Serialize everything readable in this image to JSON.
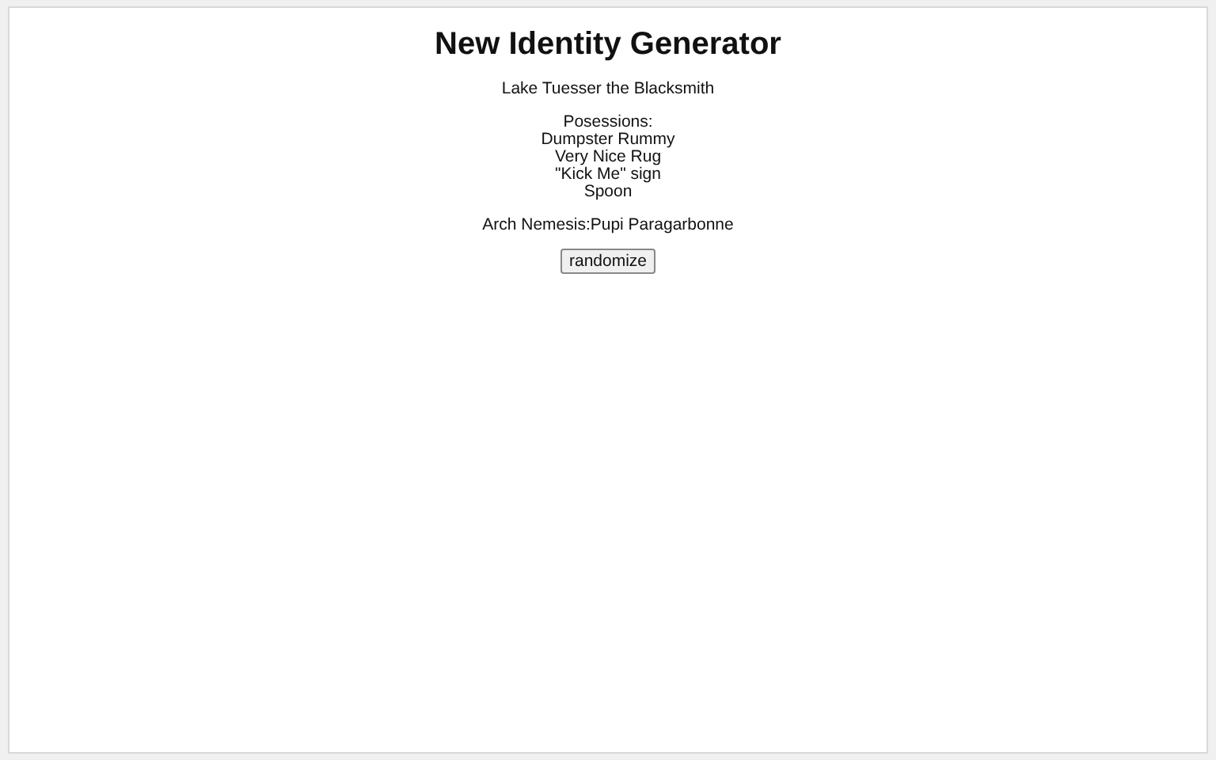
{
  "title": "New Identity Generator",
  "identity": "Lake Tuesser the Blacksmith",
  "possessions_label": "Posessions:",
  "possessions": [
    "Dumpster Rummy",
    "Very Nice Rug",
    "\"Kick Me\" sign",
    "Spoon"
  ],
  "nemesis": "Arch Nemesis:Pupi Paragarbonne",
  "button": "randomize"
}
